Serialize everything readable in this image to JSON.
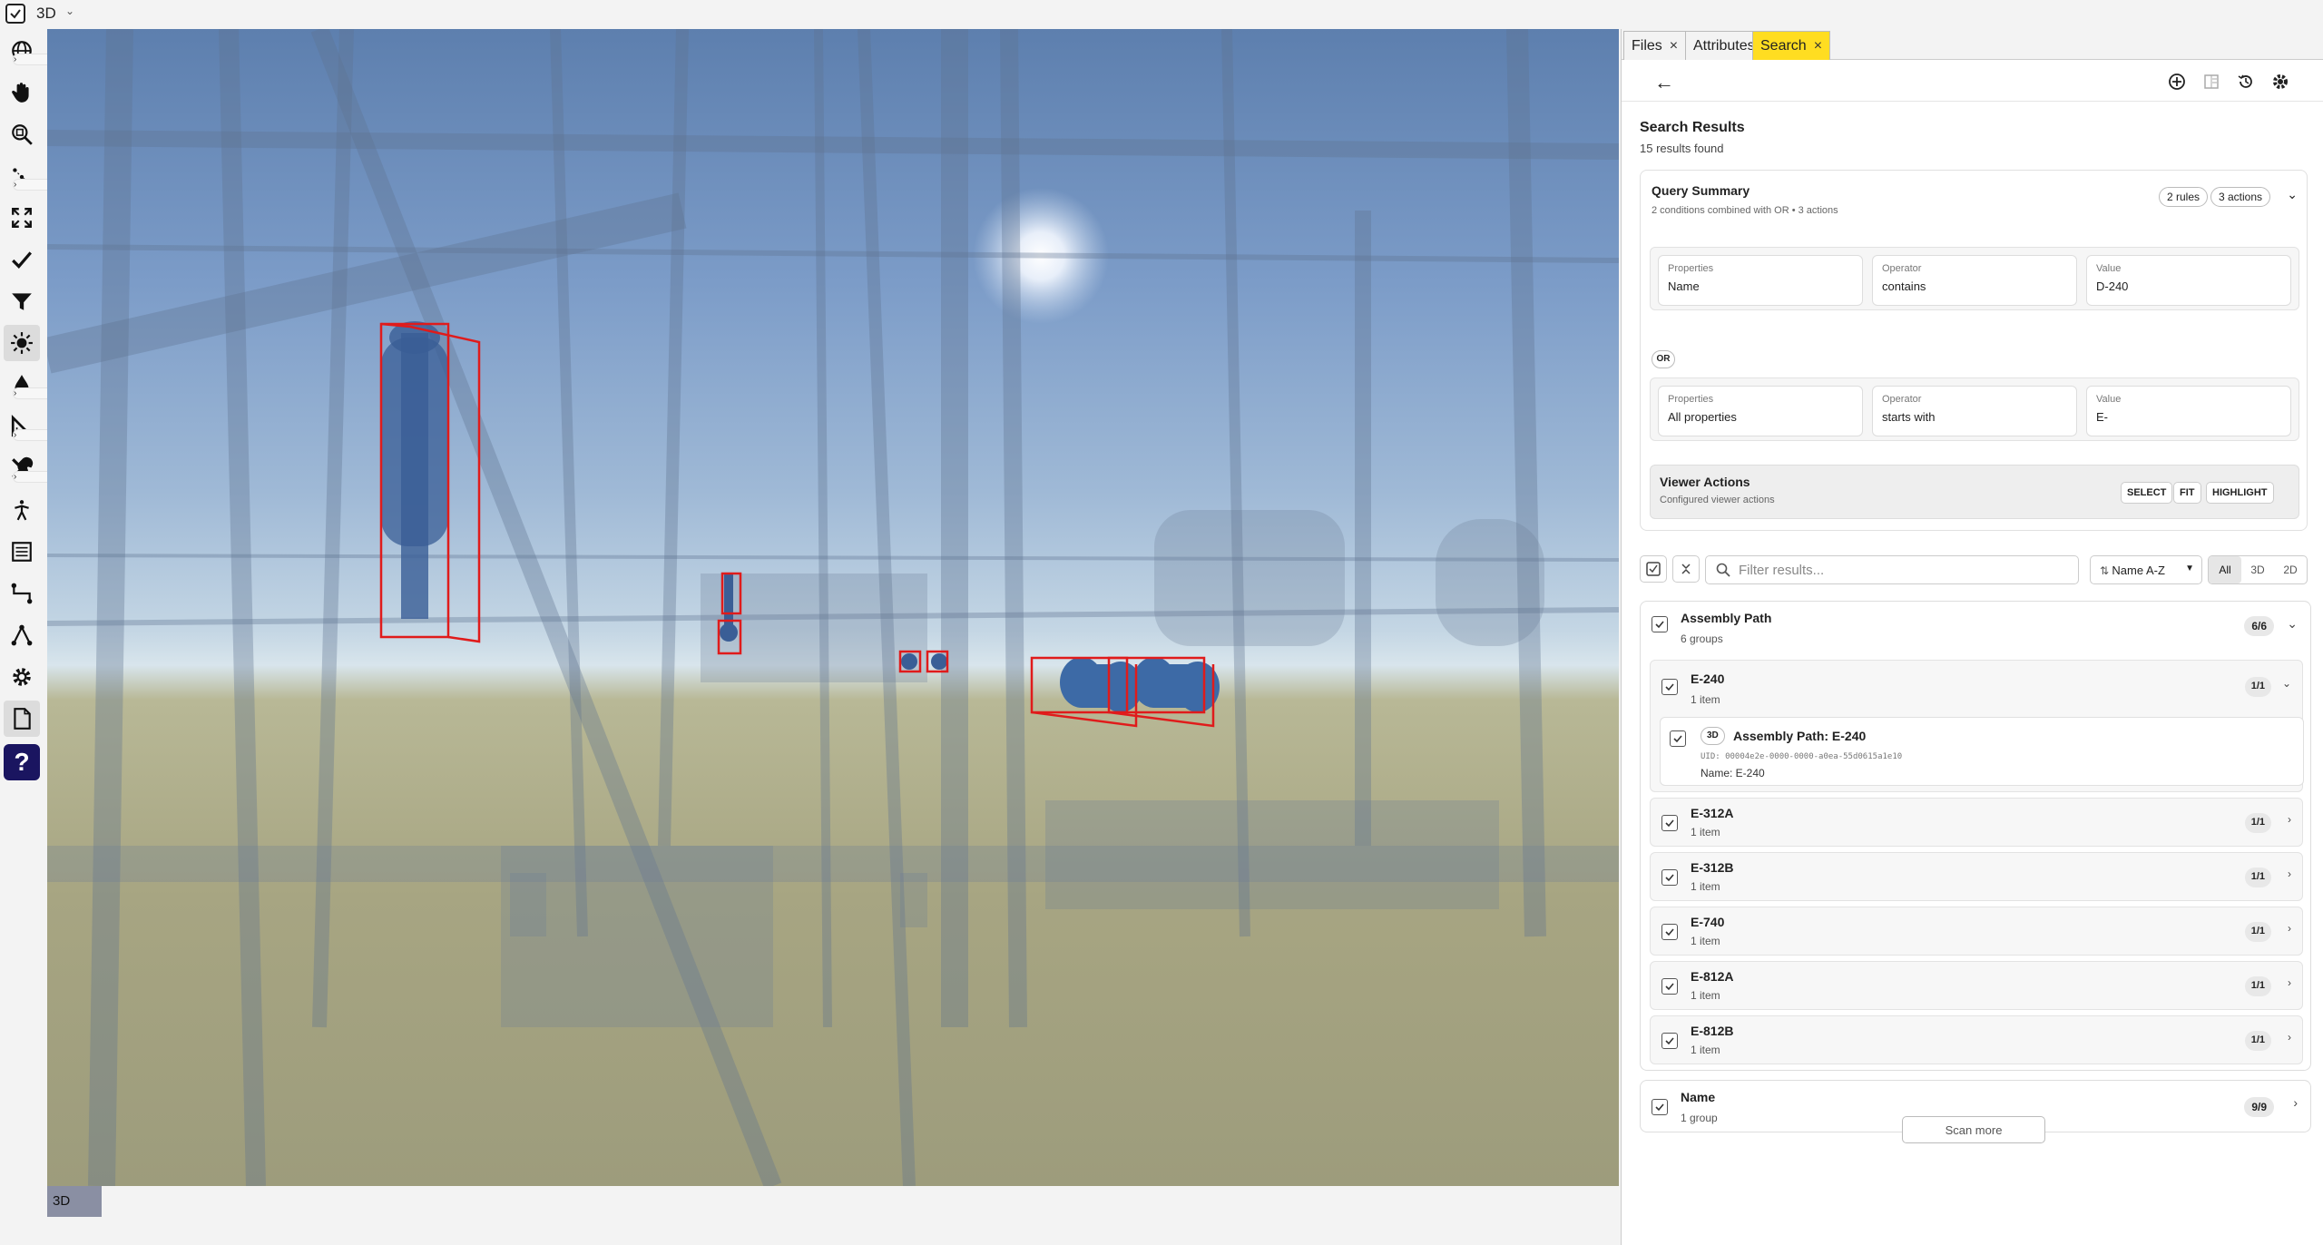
{
  "topbar": {
    "view_label": "3D"
  },
  "toolbar": {
    "tools": [
      "globe-icon",
      "hand-icon",
      "zoom-region-icon",
      "points-icon",
      "fit-icon",
      "check-icon",
      "filter-icon",
      "light-icon",
      "drop-icon",
      "measure-icon",
      "tools-icon",
      "walk-icon",
      "list-icon",
      "connector-icon",
      "graph-icon",
      "settings-icon",
      "document-icon",
      "help-icon"
    ],
    "help_label": "?"
  },
  "viewport": {
    "tag": "3D"
  },
  "tabs": [
    {
      "label": "Files",
      "close": "×"
    },
    {
      "label": "Attributes",
      "close": ""
    },
    {
      "label": "Search",
      "close": "×"
    }
  ],
  "results": {
    "title": "Search Results",
    "count": "15 results found"
  },
  "query": {
    "title": "Query Summary",
    "desc": "2 conditions combined with OR • 3 actions",
    "rules_pill": "2 rules",
    "actions_pill": "3 actions",
    "rules": [
      {
        "p_label": "Properties",
        "p_value": "Name",
        "o_label": "Operator",
        "o_value": "contains",
        "v_label": "Value",
        "v_value": "D-240"
      },
      {
        "p_label": "Properties",
        "p_value": "All properties",
        "o_label": "Operator",
        "o_value": "starts with",
        "v_label": "Value",
        "v_value": "E-"
      }
    ],
    "combinator": "OR",
    "viewer_actions": {
      "title": "Viewer Actions",
      "desc": "Configured viewer actions",
      "actions": [
        "SELECT",
        "FIT",
        "HIGHLIGHT"
      ]
    }
  },
  "filter": {
    "placeholder": "Filter results...",
    "sort": "Name A-Z",
    "segments": [
      "All",
      "3D",
      "2D"
    ]
  },
  "groups": [
    {
      "title": "Assembly Path",
      "subtitle": "6 groups",
      "count": "6/6",
      "subgroups": [
        {
          "title": "E-240",
          "subtitle": "1 item",
          "count": "1/1",
          "item": {
            "badge": "3D",
            "title": "Assembly Path: E-240",
            "uid": "UID: 00004e2e-0000-0000-a0ea-55d0615a1e10",
            "name": "Name: E-240"
          }
        },
        {
          "title": "E-312A",
          "subtitle": "1 item",
          "count": "1/1"
        },
        {
          "title": "E-312B",
          "subtitle": "1 item",
          "count": "1/1"
        },
        {
          "title": "E-740",
          "subtitle": "1 item",
          "count": "1/1"
        },
        {
          "title": "E-812A",
          "subtitle": "1 item",
          "count": "1/1"
        },
        {
          "title": "E-812B",
          "subtitle": "1 item",
          "count": "1/1"
        }
      ]
    },
    {
      "title": "Name",
      "subtitle": "1 group",
      "count": "9/9"
    }
  ],
  "scan_more": "Scan more",
  "colors": {
    "accent_tab": "#ffdd21",
    "highlight_box": "#e01b1b",
    "help_bg": "#1a1560"
  }
}
